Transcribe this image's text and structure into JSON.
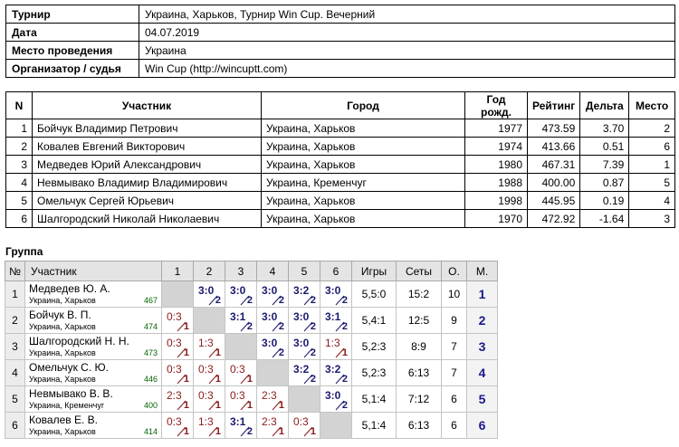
{
  "info": [
    {
      "label": "Турнир",
      "value": "Украина, Харьков, Турнир Win Cup. Вечерний"
    },
    {
      "label": "Дата",
      "value": "04.07.2019"
    },
    {
      "label": "Место проведения",
      "value": "Украина"
    },
    {
      "label": "Организатор / судья",
      "value": "Win Cup (http://wincuptt.com)"
    }
  ],
  "participants": {
    "headers": {
      "n": "N",
      "name": "Участник",
      "city": "Город",
      "year": "Год рожд.",
      "rating": "Рейтинг",
      "delta": "Дельта",
      "place": "Место"
    },
    "rows": [
      {
        "n": "1",
        "name": "Бойчук Владимир Петрович",
        "city": "Украина, Харьков",
        "year": "1977",
        "rating": "473.59",
        "delta": "3.70",
        "place": "2"
      },
      {
        "n": "2",
        "name": "Ковалев Евгений Викторович",
        "city": "Украина, Харьков",
        "year": "1974",
        "rating": "413.66",
        "delta": "0.51",
        "place": "6"
      },
      {
        "n": "3",
        "name": "Медведев Юрий Александрович",
        "city": "Украина, Харьков",
        "year": "1980",
        "rating": "467.31",
        "delta": "7.39",
        "place": "1"
      },
      {
        "n": "4",
        "name": "Невмывако Владимир Владимирович",
        "city": "Украина, Кременчуг",
        "year": "1988",
        "rating": "400.00",
        "delta": "0.87",
        "place": "5"
      },
      {
        "n": "5",
        "name": "Омельчук Сергей Юрьевич",
        "city": "Украина, Харьков",
        "year": "1998",
        "rating": "445.95",
        "delta": "0.19",
        "place": "4"
      },
      {
        "n": "6",
        "name": "Шалгородский Николай Николаевич",
        "city": "Украина, Харьков",
        "year": "1970",
        "rating": "472.92",
        "delta": "-1.64",
        "place": "3"
      }
    ]
  },
  "group": {
    "title": "Группа",
    "headers": {
      "n": "№",
      "player": "Участник",
      "cols": [
        "1",
        "2",
        "3",
        "4",
        "5",
        "6"
      ],
      "games": "Игры",
      "sets": "Сеты",
      "points": "О.",
      "place": "М."
    },
    "rows": [
      {
        "n": "1",
        "name": "Медведев Ю. А.",
        "city": "Украина, Харьков",
        "rating": "467",
        "cells": [
          null,
          {
            "s": "3:0",
            "p": "2",
            "r": "win"
          },
          {
            "s": "3:0",
            "p": "2",
            "r": "win"
          },
          {
            "s": "3:0",
            "p": "2",
            "r": "win"
          },
          {
            "s": "3:2",
            "p": "2",
            "r": "win"
          },
          {
            "s": "3:0",
            "p": "2",
            "r": "win"
          }
        ],
        "games": "5,5:0",
        "sets": "15:2",
        "points": "10",
        "place": "1"
      },
      {
        "n": "2",
        "name": "Бойчук В. П.",
        "city": "Украина, Харьков",
        "rating": "474",
        "cells": [
          {
            "s": "0:3",
            "p": "1",
            "r": "loss"
          },
          null,
          {
            "s": "3:1",
            "p": "2",
            "r": "win"
          },
          {
            "s": "3:0",
            "p": "2",
            "r": "win"
          },
          {
            "s": "3:0",
            "p": "2",
            "r": "win"
          },
          {
            "s": "3:1",
            "p": "2",
            "r": "win"
          }
        ],
        "games": "5,4:1",
        "sets": "12:5",
        "points": "9",
        "place": "2"
      },
      {
        "n": "3",
        "name": "Шалгородский Н. Н.",
        "city": "Украина, Харьков",
        "rating": "473",
        "cells": [
          {
            "s": "0:3",
            "p": "1",
            "r": "loss"
          },
          {
            "s": "1:3",
            "p": "1",
            "r": "loss"
          },
          null,
          {
            "s": "3:0",
            "p": "2",
            "r": "win"
          },
          {
            "s": "3:0",
            "p": "2",
            "r": "win"
          },
          {
            "s": "1:3",
            "p": "1",
            "r": "loss"
          }
        ],
        "games": "5,2:3",
        "sets": "8:9",
        "points": "7",
        "place": "3"
      },
      {
        "n": "4",
        "name": "Омельчук С. Ю.",
        "city": "Украина, Харьков",
        "rating": "446",
        "cells": [
          {
            "s": "0:3",
            "p": "1",
            "r": "loss"
          },
          {
            "s": "0:3",
            "p": "1",
            "r": "loss"
          },
          {
            "s": "0:3",
            "p": "1",
            "r": "loss"
          },
          null,
          {
            "s": "3:2",
            "p": "2",
            "r": "win"
          },
          {
            "s": "3:2",
            "p": "2",
            "r": "win"
          }
        ],
        "games": "5,2:3",
        "sets": "6:13",
        "points": "7",
        "place": "4"
      },
      {
        "n": "5",
        "name": "Невмывако В. В.",
        "city": "Украина, Кременчуг",
        "rating": "400",
        "cells": [
          {
            "s": "2:3",
            "p": "1",
            "r": "loss"
          },
          {
            "s": "0:3",
            "p": "1",
            "r": "loss"
          },
          {
            "s": "0:3",
            "p": "1",
            "r": "loss"
          },
          {
            "s": "2:3",
            "p": "1",
            "r": "loss"
          },
          null,
          {
            "s": "3:0",
            "p": "2",
            "r": "win"
          }
        ],
        "games": "5,1:4",
        "sets": "7:12",
        "points": "6",
        "place": "5"
      },
      {
        "n": "6",
        "name": "Ковалев Е. В.",
        "city": "Украина, Харьков",
        "rating": "414",
        "cells": [
          {
            "s": "0:3",
            "p": "1",
            "r": "loss"
          },
          {
            "s": "1:3",
            "p": "1",
            "r": "loss"
          },
          {
            "s": "3:1",
            "p": "2",
            "r": "win"
          },
          {
            "s": "2:3",
            "p": "1",
            "r": "loss"
          },
          {
            "s": "0:3",
            "p": "1",
            "r": "loss"
          },
          null
        ],
        "games": "5,1:4",
        "sets": "6:13",
        "points": "6",
        "place": "6"
      }
    ]
  }
}
